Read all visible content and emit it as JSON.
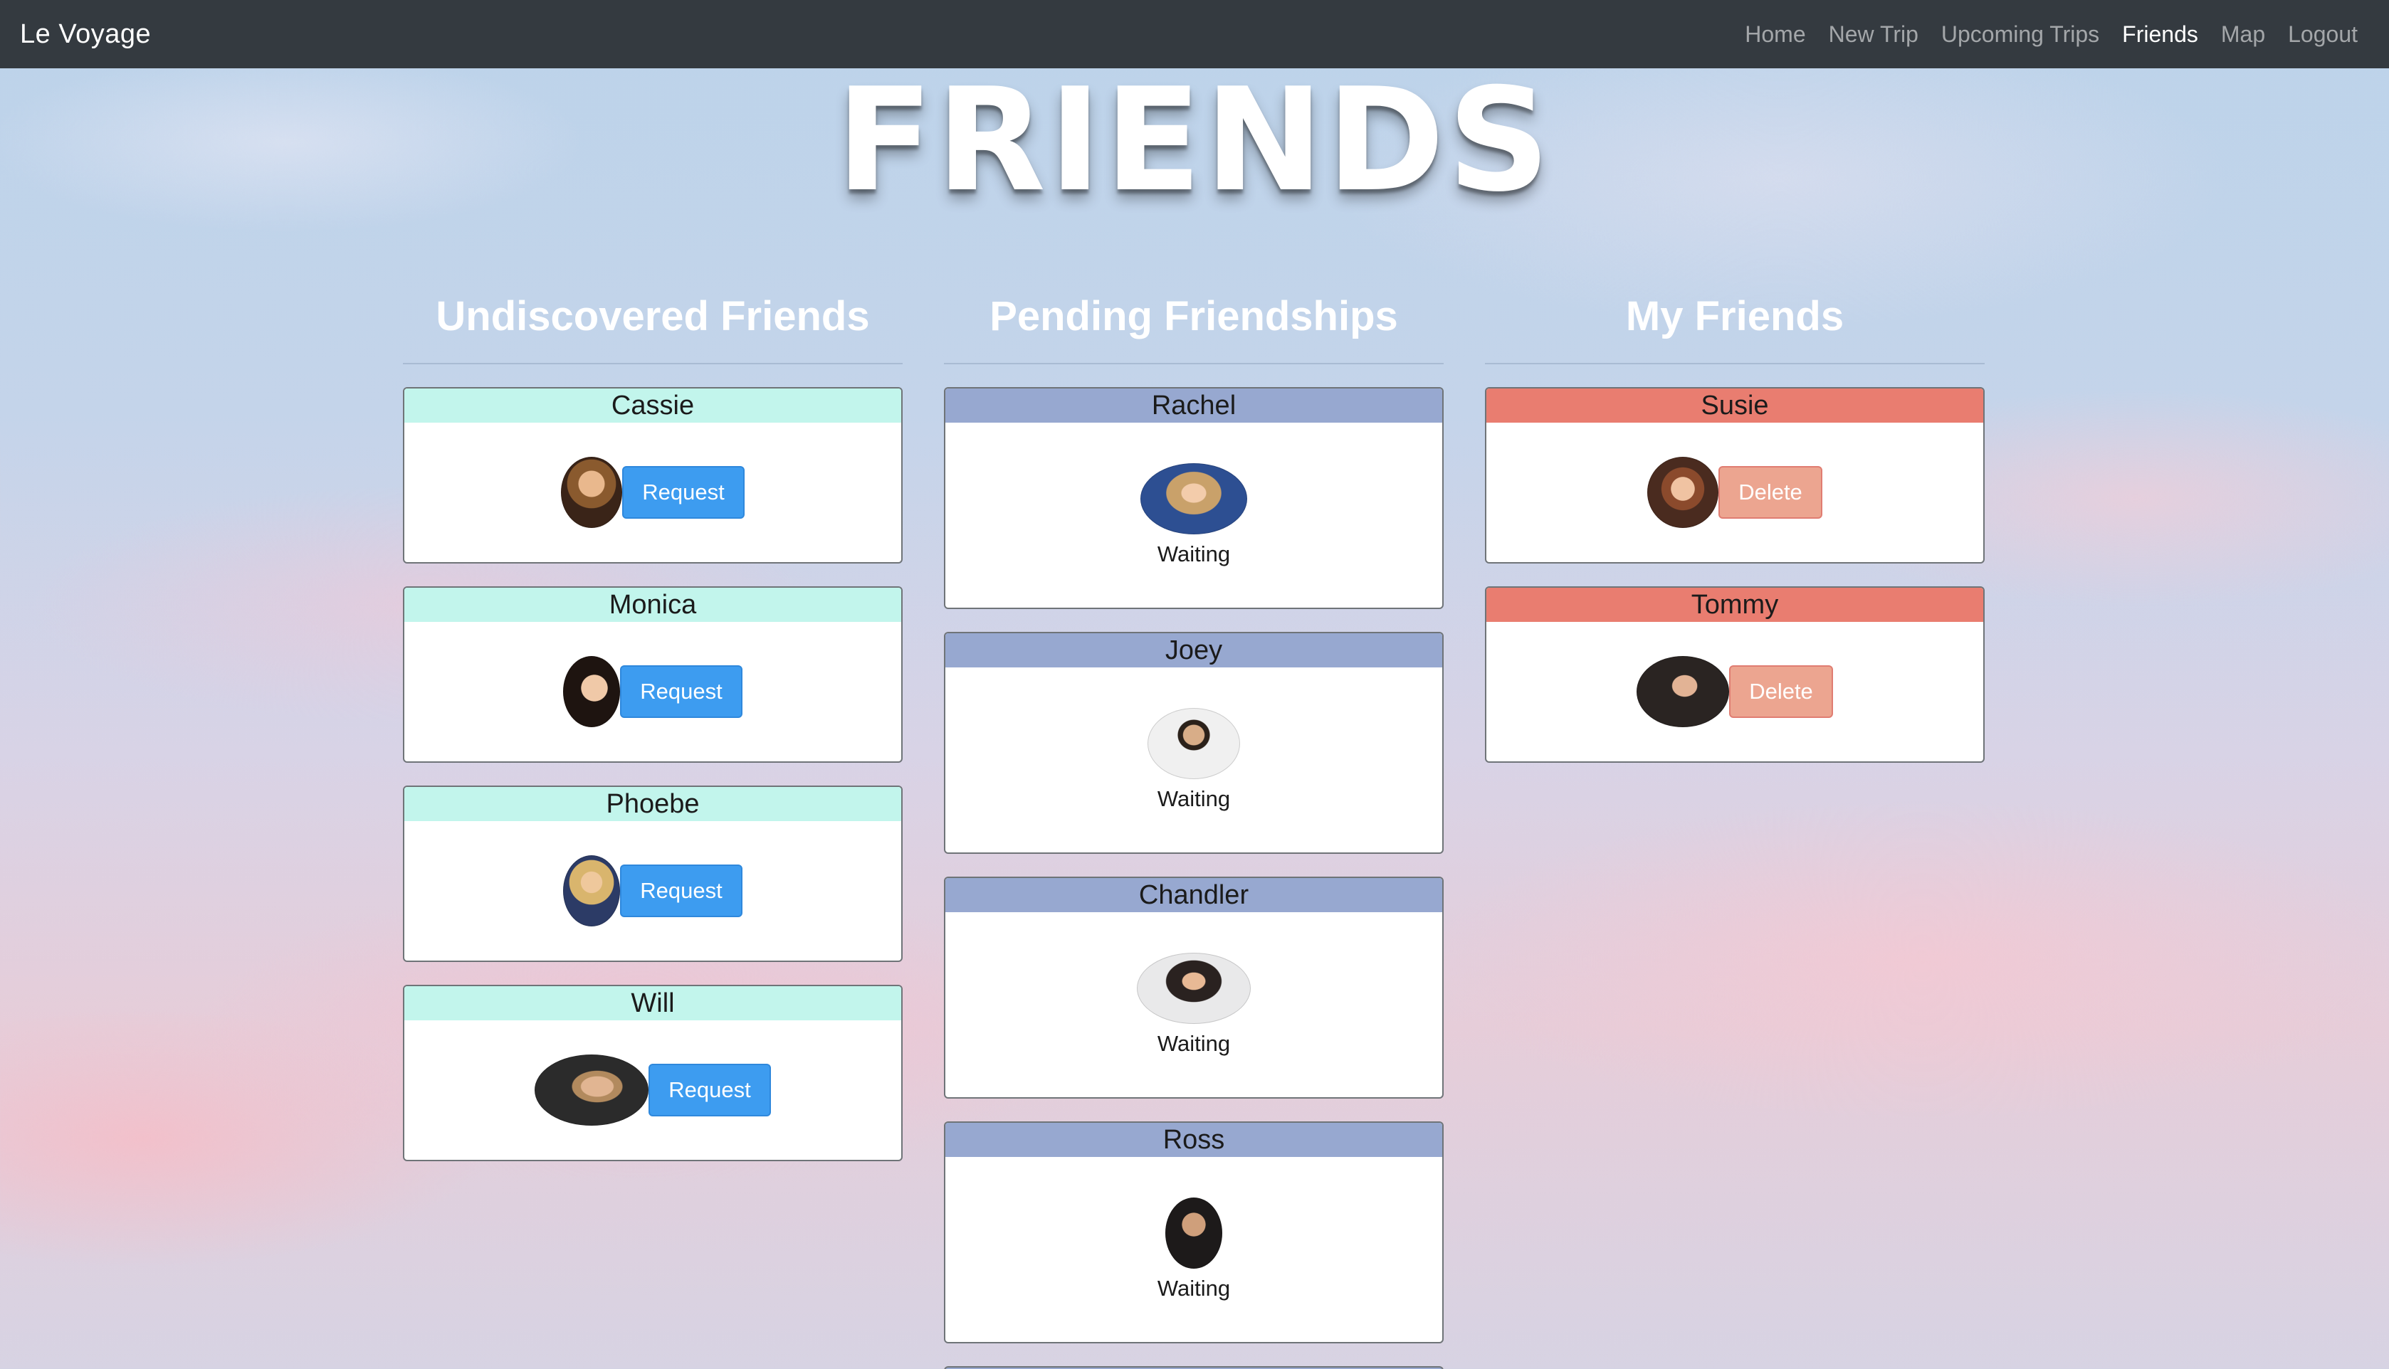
{
  "navbar": {
    "brand": "Le Voyage",
    "links": [
      {
        "label": "Home",
        "active": false
      },
      {
        "label": "New Trip",
        "active": false
      },
      {
        "label": "Upcoming Trips",
        "active": false
      },
      {
        "label": "Friends",
        "active": true
      },
      {
        "label": "Map",
        "active": false
      },
      {
        "label": "Logout",
        "active": false
      }
    ]
  },
  "page_title": "FRIENDS",
  "columns": {
    "undiscovered": {
      "title": "Undiscovered Friends",
      "friends": [
        {
          "name": "Cassie",
          "action": "Request"
        },
        {
          "name": "Monica",
          "action": "Request"
        },
        {
          "name": "Phoebe",
          "action": "Request"
        },
        {
          "name": "Will",
          "action": "Request"
        }
      ]
    },
    "pending": {
      "title": "Pending Friendships",
      "friends": [
        {
          "name": "Rachel",
          "status": "Waiting"
        },
        {
          "name": "Joey",
          "status": "Waiting"
        },
        {
          "name": "Chandler",
          "status": "Waiting"
        },
        {
          "name": "Ross",
          "status": "Waiting"
        }
      ]
    },
    "mine": {
      "title": "My Friends",
      "friends": [
        {
          "name": "Susie",
          "action": "Delete"
        },
        {
          "name": "Tommy",
          "action": "Delete"
        }
      ]
    }
  },
  "colors": {
    "navbar": "#343a40",
    "undiscovered_header": "#c2f5ec",
    "pending_header": "#97a8d0",
    "mine_header": "#e97d70",
    "request_button": "#3d9cf0",
    "delete_button": "#eca590"
  }
}
